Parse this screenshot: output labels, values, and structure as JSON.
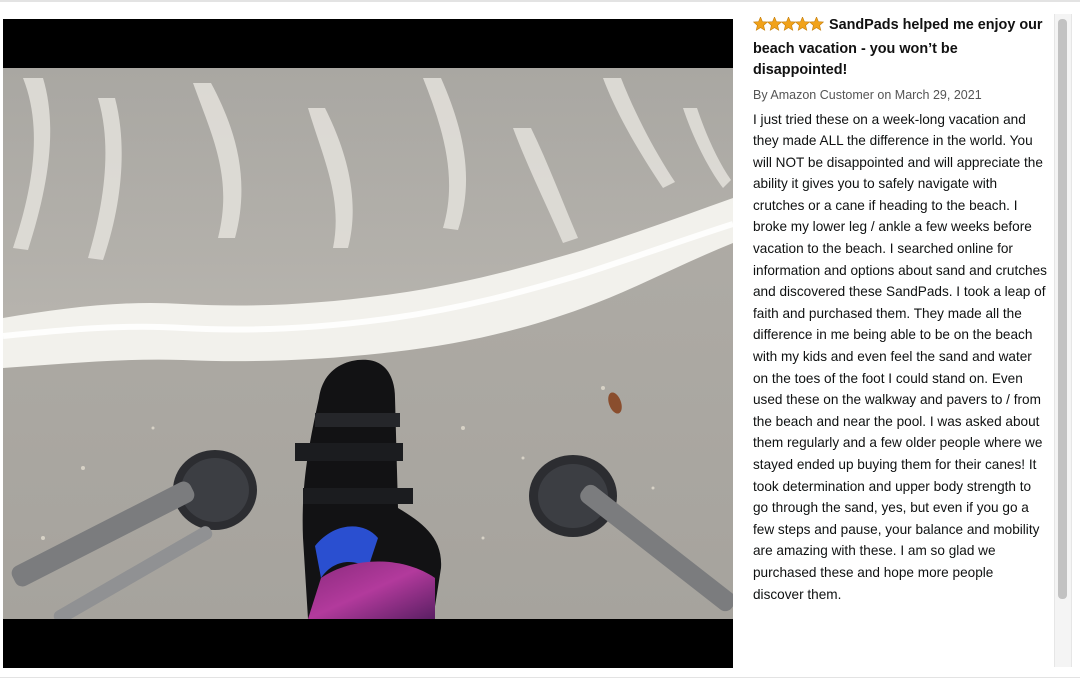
{
  "review": {
    "rating": 5,
    "rating_max": 5,
    "star_color": "#f1a21a",
    "star_icon": "star-icon",
    "title": "SandPads helped me enjoy our beach vacation - you won’t be disappointed!",
    "author_prefix": "By",
    "author": "Amazon Customer",
    "date_prefix": "on",
    "date": "March 29, 2021",
    "body": "I just tried these on a week-long vacation and they made ALL the difference in the world. You will NOT be disappointed and will appreciate the ability it gives you to safely navigate with crutches or a cane if heading to the beach. I broke my lower leg / ankle a few weeks before vacation to the beach. I searched online for information and options about sand and crutches and discovered these SandPads. I took a leap of faith and purchased them. They made all the difference in me being able to be on the beach with my kids and even feel the sand and water on the toes of the foot I could stand on. Even used these on the walkway and pavers to / from the beach and near the pool. I was asked about them regularly and a few older people where we stayed ended up buying them for their canes! It took determination and upper body strength to go through the sand, yes, but even if you go a few steps and pause, your balance and mobility are amazing with these. I am so glad we purchased these and hope more people discover them."
  }
}
